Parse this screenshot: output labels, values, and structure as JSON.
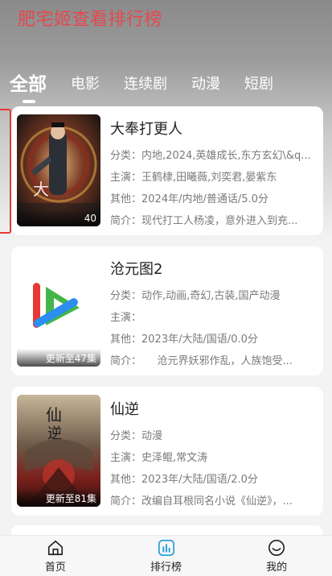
{
  "app": {
    "title": "肥宅姬查看排行榜"
  },
  "tabs": [
    {
      "label": "全部"
    },
    {
      "label": "电影"
    },
    {
      "label": "连续剧"
    },
    {
      "label": "动漫"
    },
    {
      "label": "短剧"
    }
  ],
  "items": [
    {
      "title": "大奉打更人",
      "badge": "40",
      "category_label": "分类：",
      "category": "内地,2024,英雄成长,东方玄幻\\&q...",
      "cast_label": "主演：",
      "cast": "王鹤棣,田曦薇,刘奕君,晏紫东",
      "other_label": "其他：",
      "other": "2024年/内地/普通话/5.0分",
      "intro_label": "简介：",
      "intro": "现代打工人杨凌，意外进入到充..."
    },
    {
      "title": "沧元图2",
      "badge": "更新至47集",
      "category_label": "分类：",
      "category": "动作,动画,奇幻,古装,国产动漫",
      "cast_label": "主演：",
      "cast": "",
      "other_label": "其他：",
      "other": "2023年/大陆/国语/0.0分",
      "intro_label": "简介：",
      "intro": "　　沧元界妖邪作乱，人族饱受..."
    },
    {
      "title": "仙逆",
      "badge": "更新至81集",
      "category_label": "分类：",
      "category": "动漫",
      "cast_label": "主演：",
      "cast": "史泽鲲,常文涛",
      "other_label": "其他：",
      "other": "2023年/大陆/国语/2.0分",
      "intro_label": "简介：",
      "intro": "改编自耳根同名小说《仙逆》，..."
    }
  ],
  "nav": [
    {
      "label": "首页",
      "icon": "home-icon"
    },
    {
      "label": "排行榜",
      "icon": "chart-icon"
    },
    {
      "label": "我的",
      "icon": "smile-icon"
    }
  ],
  "colors": {
    "title": "#e5484d",
    "active_nav": "#1e9bd7",
    "play_red": "#e53935",
    "play_green": "#43b649",
    "play_blue": "#2b8ef0"
  }
}
